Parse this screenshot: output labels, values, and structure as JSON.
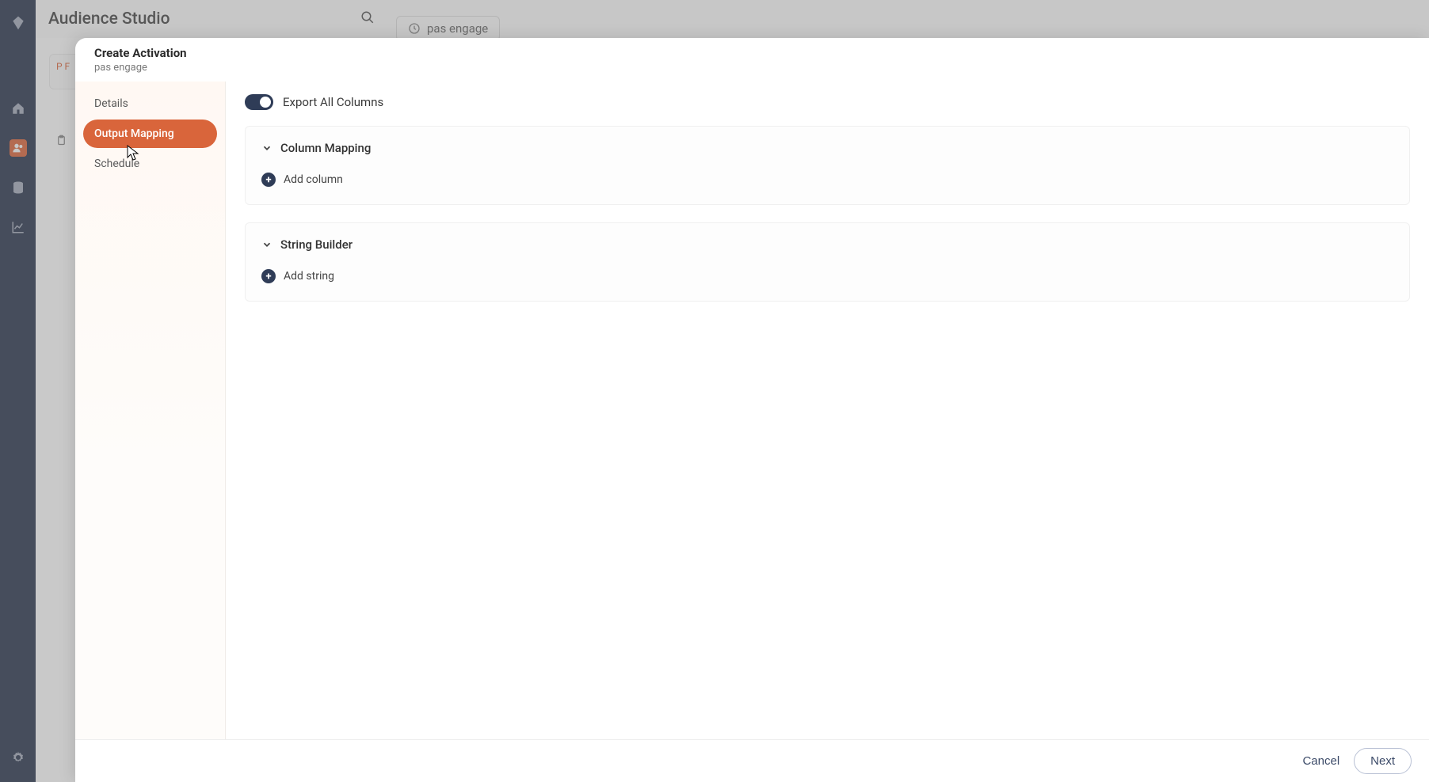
{
  "app": {
    "title": "Audience Studio",
    "tab_chip": "pas engage",
    "card_stub": "P\nF"
  },
  "modal": {
    "title": "Create Activation",
    "subtitle": "pas engage",
    "steps": [
      "Details",
      "Output Mapping",
      "Schedule"
    ],
    "active_step_index": 1,
    "toggle_label": "Export All Columns",
    "toggle_on": true,
    "panels": {
      "column_mapping": {
        "title": "Column Mapping",
        "add_label": "Add column"
      },
      "string_builder": {
        "title": "String Builder",
        "add_label": "Add string"
      }
    },
    "footer": {
      "cancel": "Cancel",
      "next": "Next"
    }
  }
}
